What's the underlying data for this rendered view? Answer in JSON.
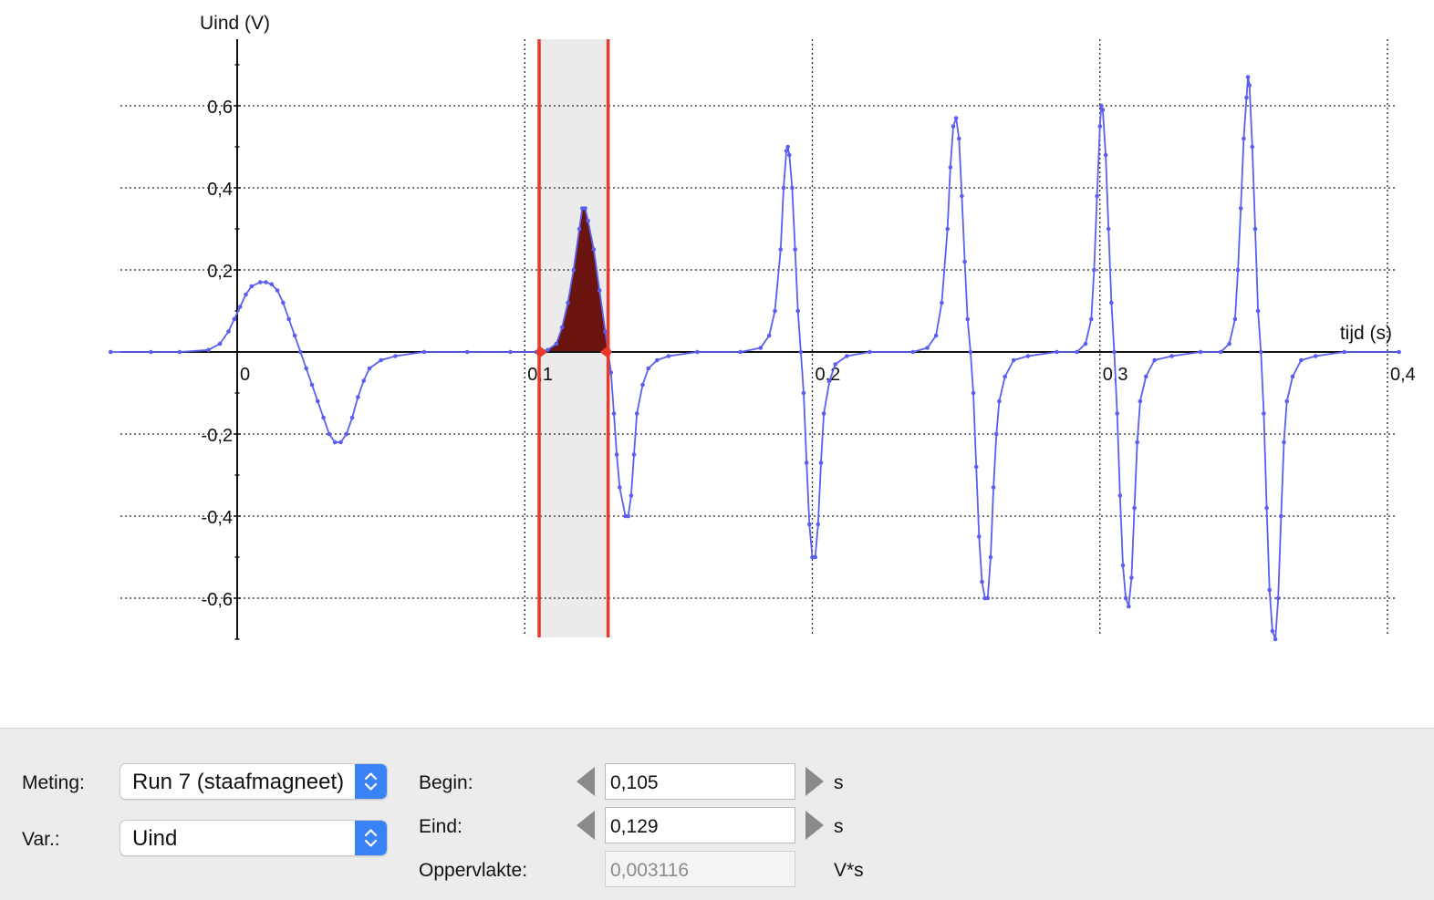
{
  "chart_data": {
    "type": "line",
    "title": "",
    "xlabel": "tijd (s)",
    "ylabel": "Uind (V)",
    "xlim": [
      -0.044,
      0.404
    ],
    "ylim": [
      -0.7,
      0.76
    ],
    "xticks": [
      {
        "value": 0,
        "label": "0"
      },
      {
        "value": 0.1,
        "label": "0,1"
      },
      {
        "value": 0.2,
        "label": "0,2"
      },
      {
        "value": 0.3,
        "label": "0,3"
      },
      {
        "value": 0.4,
        "label": "0,4"
      }
    ],
    "yticks": [
      {
        "value": 0.6,
        "label": "0,6"
      },
      {
        "value": 0.4,
        "label": "0,4"
      },
      {
        "value": 0.2,
        "label": "0,2"
      },
      {
        "value": -0.2,
        "label": "-0,2"
      },
      {
        "value": -0.4,
        "label": "-0,4"
      },
      {
        "value": -0.6,
        "label": "-0,6"
      }
    ],
    "grid": true,
    "line_color": "#5b5ff0",
    "shade_color": "#ebebeb",
    "area_color": "#6b1410",
    "cursor_color": "#e8392b",
    "selection": {
      "begin": 0.105,
      "end": 0.129
    },
    "series": [
      {
        "values": [
          [
            -0.044,
            0.0
          ],
          [
            -0.03,
            0.0
          ],
          [
            -0.02,
            0.0
          ],
          [
            -0.01,
            0.005
          ],
          [
            -0.006,
            0.02
          ],
          [
            -0.003,
            0.05
          ],
          [
            -0.001,
            0.08
          ],
          [
            0.001,
            0.11
          ],
          [
            0.003,
            0.14
          ],
          [
            0.005,
            0.16
          ],
          [
            0.008,
            0.17
          ],
          [
            0.01,
            0.17
          ],
          [
            0.012,
            0.165
          ],
          [
            0.014,
            0.15
          ],
          [
            0.016,
            0.12
          ],
          [
            0.018,
            0.08
          ],
          [
            0.02,
            0.04
          ],
          [
            0.022,
            0.0
          ],
          [
            0.024,
            -0.04
          ],
          [
            0.026,
            -0.08
          ],
          [
            0.028,
            -0.12
          ],
          [
            0.03,
            -0.16
          ],
          [
            0.032,
            -0.2
          ],
          [
            0.034,
            -0.22
          ],
          [
            0.036,
            -0.22
          ],
          [
            0.038,
            -0.2
          ],
          [
            0.04,
            -0.16
          ],
          [
            0.042,
            -0.11
          ],
          [
            0.044,
            -0.07
          ],
          [
            0.046,
            -0.04
          ],
          [
            0.05,
            -0.02
          ],
          [
            0.055,
            -0.01
          ],
          [
            0.065,
            0.0
          ],
          [
            0.08,
            0.0
          ],
          [
            0.095,
            0.0
          ],
          [
            0.104,
            0.0
          ],
          [
            0.108,
            0.005
          ],
          [
            0.111,
            0.02
          ],
          [
            0.113,
            0.06
          ],
          [
            0.115,
            0.12
          ],
          [
            0.117,
            0.2
          ],
          [
            0.119,
            0.3
          ],
          [
            0.12,
            0.35
          ],
          [
            0.121,
            0.35
          ],
          [
            0.122,
            0.32
          ],
          [
            0.124,
            0.25
          ],
          [
            0.126,
            0.15
          ],
          [
            0.128,
            0.05
          ],
          [
            0.129,
            0.0
          ],
          [
            0.13,
            -0.05
          ],
          [
            0.131,
            -0.15
          ],
          [
            0.132,
            -0.25
          ],
          [
            0.133,
            -0.33
          ],
          [
            0.135,
            -0.4
          ],
          [
            0.136,
            -0.4
          ],
          [
            0.137,
            -0.35
          ],
          [
            0.138,
            -0.25
          ],
          [
            0.139,
            -0.15
          ],
          [
            0.141,
            -0.08
          ],
          [
            0.143,
            -0.04
          ],
          [
            0.146,
            -0.02
          ],
          [
            0.15,
            -0.01
          ],
          [
            0.16,
            0.0
          ],
          [
            0.175,
            0.0
          ],
          [
            0.182,
            0.01
          ],
          [
            0.185,
            0.04
          ],
          [
            0.187,
            0.1
          ],
          [
            0.189,
            0.25
          ],
          [
            0.19,
            0.4
          ],
          [
            0.191,
            0.49
          ],
          [
            0.1915,
            0.5
          ],
          [
            0.192,
            0.48
          ],
          [
            0.193,
            0.4
          ],
          [
            0.194,
            0.25
          ],
          [
            0.195,
            0.1
          ],
          [
            0.196,
            0.0
          ],
          [
            0.197,
            -0.1
          ],
          [
            0.198,
            -0.27
          ],
          [
            0.199,
            -0.42
          ],
          [
            0.2,
            -0.5
          ],
          [
            0.201,
            -0.5
          ],
          [
            0.202,
            -0.42
          ],
          [
            0.203,
            -0.27
          ],
          [
            0.204,
            -0.15
          ],
          [
            0.206,
            -0.07
          ],
          [
            0.208,
            -0.03
          ],
          [
            0.212,
            -0.01
          ],
          [
            0.22,
            0.0
          ],
          [
            0.235,
            0.0
          ],
          [
            0.24,
            0.01
          ],
          [
            0.243,
            0.04
          ],
          [
            0.245,
            0.12
          ],
          [
            0.247,
            0.3
          ],
          [
            0.248,
            0.45
          ],
          [
            0.249,
            0.55
          ],
          [
            0.25,
            0.57
          ],
          [
            0.251,
            0.52
          ],
          [
            0.252,
            0.38
          ],
          [
            0.253,
            0.22
          ],
          [
            0.254,
            0.08
          ],
          [
            0.255,
            0.0
          ],
          [
            0.256,
            -0.1
          ],
          [
            0.257,
            -0.28
          ],
          [
            0.258,
            -0.45
          ],
          [
            0.259,
            -0.56
          ],
          [
            0.26,
            -0.6
          ],
          [
            0.261,
            -0.6
          ],
          [
            0.262,
            -0.5
          ],
          [
            0.263,
            -0.33
          ],
          [
            0.264,
            -0.2
          ],
          [
            0.265,
            -0.12
          ],
          [
            0.267,
            -0.06
          ],
          [
            0.27,
            -0.02
          ],
          [
            0.275,
            -0.01
          ],
          [
            0.285,
            0.0
          ],
          [
            0.292,
            0.0
          ],
          [
            0.295,
            0.02
          ],
          [
            0.297,
            0.08
          ],
          [
            0.298,
            0.2
          ],
          [
            0.299,
            0.38
          ],
          [
            0.3,
            0.55
          ],
          [
            0.3005,
            0.6
          ],
          [
            0.301,
            0.59
          ],
          [
            0.302,
            0.48
          ],
          [
            0.303,
            0.3
          ],
          [
            0.304,
            0.12
          ],
          [
            0.305,
            0.0
          ],
          [
            0.306,
            -0.15
          ],
          [
            0.307,
            -0.35
          ],
          [
            0.308,
            -0.52
          ],
          [
            0.309,
            -0.6
          ],
          [
            0.31,
            -0.62
          ],
          [
            0.311,
            -0.55
          ],
          [
            0.312,
            -0.38
          ],
          [
            0.313,
            -0.22
          ],
          [
            0.314,
            -0.12
          ],
          [
            0.316,
            -0.06
          ],
          [
            0.319,
            -0.02
          ],
          [
            0.325,
            -0.01
          ],
          [
            0.335,
            0.0
          ],
          [
            0.342,
            0.0
          ],
          [
            0.345,
            0.02
          ],
          [
            0.347,
            0.08
          ],
          [
            0.348,
            0.2
          ],
          [
            0.349,
            0.35
          ],
          [
            0.35,
            0.52
          ],
          [
            0.351,
            0.62
          ],
          [
            0.3515,
            0.67
          ],
          [
            0.352,
            0.65
          ],
          [
            0.353,
            0.5
          ],
          [
            0.354,
            0.3
          ],
          [
            0.355,
            0.1
          ],
          [
            0.356,
            0.0
          ],
          [
            0.357,
            -0.15
          ],
          [
            0.358,
            -0.38
          ],
          [
            0.359,
            -0.58
          ],
          [
            0.36,
            -0.68
          ],
          [
            0.361,
            -0.7
          ],
          [
            0.362,
            -0.6
          ],
          [
            0.363,
            -0.4
          ],
          [
            0.364,
            -0.22
          ],
          [
            0.365,
            -0.12
          ],
          [
            0.367,
            -0.06
          ],
          [
            0.37,
            -0.02
          ],
          [
            0.375,
            -0.01
          ],
          [
            0.385,
            0.0
          ],
          [
            0.404,
            0.0
          ]
        ]
      }
    ]
  },
  "panel": {
    "meting_label": "Meting:",
    "meting_value": "Run 7 (staafmagneet)",
    "var_label": "Var.:",
    "var_value": "Uind",
    "begin_label": "Begin:",
    "begin_value": "0,105",
    "begin_unit": "s",
    "eind_label": "Eind:",
    "eind_value": "0,129",
    "eind_unit": "s",
    "oppervlakte_label": "Oppervlakte:",
    "oppervlakte_value": "0,003116",
    "oppervlakte_unit": "V*s"
  }
}
